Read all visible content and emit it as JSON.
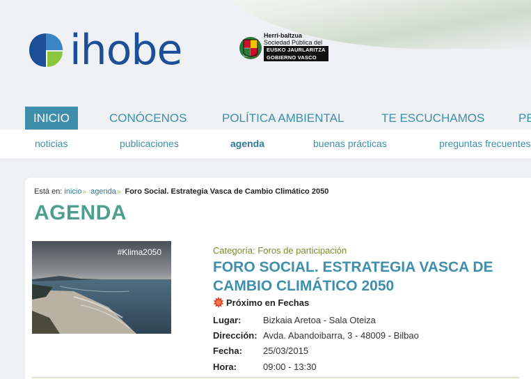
{
  "header": {
    "brand_name": "ihobe",
    "gov_line1": "Herri-baltzua",
    "gov_line2": "Sociedad Pública del",
    "gov_box_line1": "EUSKO JAURLARITZA",
    "gov_box_line2": "GOBIERNO VASCO"
  },
  "main_nav": {
    "items": [
      "INICIO",
      "CONÓCENOS",
      "POLÍTICA AMBIENTAL",
      "TE ESCUCHAMOS",
      "PE"
    ]
  },
  "sub_nav": {
    "items": [
      "noticias",
      "publicaciones",
      "agenda",
      "buenas prácticas",
      "preguntas frecuentes"
    ]
  },
  "breadcrumb": {
    "prefix": "Está en:",
    "items": [
      "inicio",
      "agenda"
    ],
    "current": "Foro Social. Estrategia Vasca de Cambio Climático 2050"
  },
  "section_title": "AGENDA",
  "event": {
    "image_hashtag": "#Klima2050",
    "category": "Categoría: Foros de participación",
    "title": "FORO SOCIAL. ESTRATEGIA VASCA DE CAMBIO CLIMÁTICO 2050",
    "status": "Próximo en Fechas",
    "details": [
      {
        "label": "Lugar:",
        "value": "Bizkaia Aretoa - Sala Oteiza"
      },
      {
        "label": "Dirección:",
        "value": "Avda. Abandoibarra, 3 - 48009 - Bilbao"
      },
      {
        "label": "Fecha:",
        "value": "25/03/2015"
      },
      {
        "label": "Hora:",
        "value": "09:00 - 13:30"
      }
    ]
  },
  "colors": {
    "brand_blue": "#1d4f96",
    "nav_teal": "#3c8fa8",
    "active_bg": "#3f8fac",
    "title_green": "#4d9e8f",
    "category_olive": "#7b8f28"
  }
}
